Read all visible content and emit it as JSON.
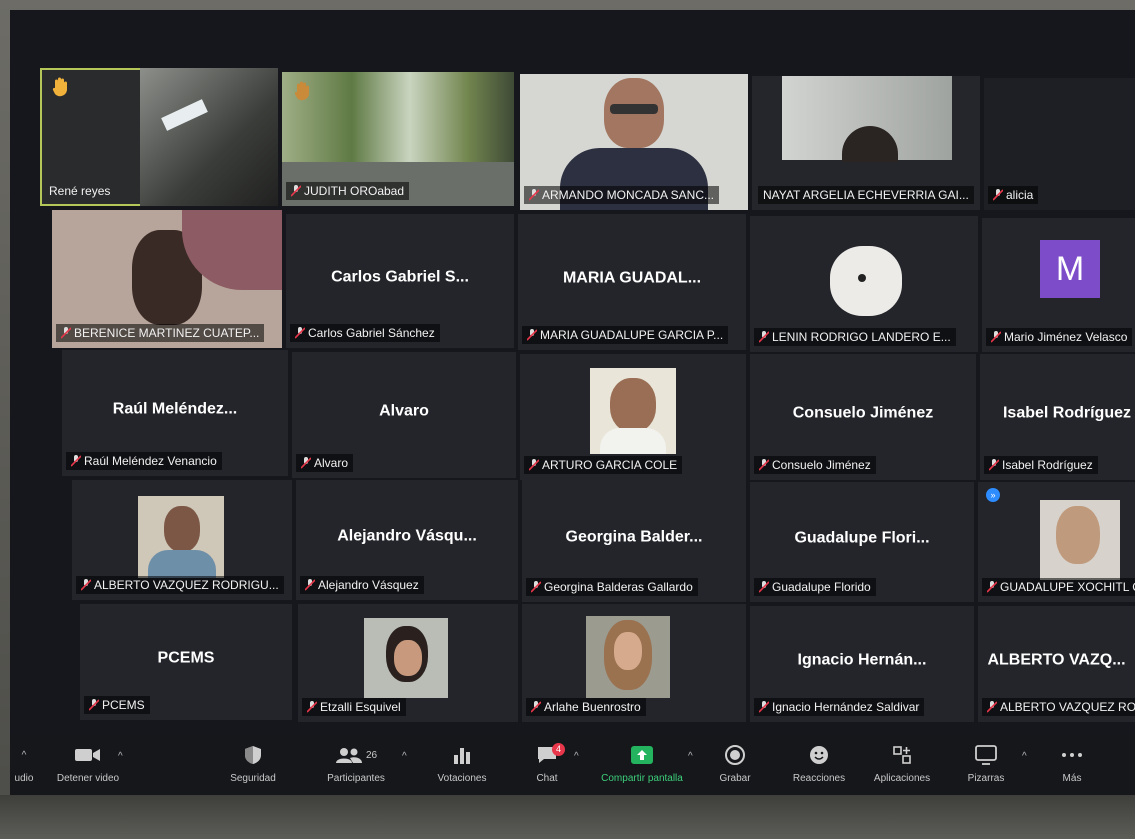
{
  "tiles": [
    {
      "center": "",
      "label": "René reyes",
      "muted": false
    },
    {
      "center": "",
      "label": "JUDITH OROabad",
      "muted": true
    },
    {
      "center": "",
      "label": "ARMANDO MONCADA SANC...",
      "muted": true
    },
    {
      "center": "",
      "label": "NAYAT ARGELIA ECHEVERRIA GAI...",
      "muted": false
    },
    {
      "center": "",
      "label": "alicia",
      "muted": true
    },
    {
      "center": "",
      "label": "BERENICE MARTINEZ CUATEP...",
      "muted": true
    },
    {
      "center": "Carlos Gabriel S...",
      "label": "Carlos Gabriel Sánchez",
      "muted": true
    },
    {
      "center": "MARIA GUADAL...",
      "label": "MARIA GUADALUPE GARCIA P...",
      "muted": true
    },
    {
      "center": "",
      "label": "LENIN RODRIGO LANDERO E...",
      "muted": true
    },
    {
      "center": "",
      "label": "Mario Jiménez Velasco",
      "muted": true,
      "avatar": "M"
    },
    {
      "center": "Raúl Meléndez...",
      "label": "Raúl Meléndez Venancio",
      "muted": true
    },
    {
      "center": "Alvaro",
      "label": "Alvaro",
      "muted": true
    },
    {
      "center": "",
      "label": "ARTURO GARCIA COLE",
      "muted": true
    },
    {
      "center": "Consuelo Jiménez",
      "label": "Consuelo Jiménez",
      "muted": true
    },
    {
      "center": "Isabel Rodríguez",
      "label": "Isabel Rodríguez",
      "muted": true
    },
    {
      "center": "",
      "label": "ALBERTO VAZQUEZ RODRIGU...",
      "muted": true
    },
    {
      "center": "Alejandro Vásqu...",
      "label": "Alejandro Vásquez",
      "muted": true
    },
    {
      "center": "Georgina Balder...",
      "label": "Georgina Balderas Gallardo",
      "muted": true
    },
    {
      "center": "Guadalupe Flori...",
      "label": "Guadalupe Florido",
      "muted": true
    },
    {
      "center": "",
      "label": "GUADALUPE XOCHITL CHAV",
      "muted": true
    },
    {
      "center": "PCEMS",
      "label": "PCEMS",
      "muted": true
    },
    {
      "center": "",
      "label": "Etzalli Esquivel",
      "muted": true
    },
    {
      "center": "",
      "label": "Arlahe Buenrostro",
      "muted": true
    },
    {
      "center": "Ignacio Hernán...",
      "label": "Ignacio Hernández Saldivar",
      "muted": true
    },
    {
      "center": "ALBERTO VAZQ...",
      "label": "ALBERTO VAZQUEZ RODRIGU",
      "muted": true
    }
  ],
  "toolbar": {
    "audio": "udio",
    "video": "Detener video",
    "security": "Seguridad",
    "participants": "Participantes",
    "participants_count": "26",
    "polls": "Votaciones",
    "chat": "Chat",
    "chat_badge": "4",
    "share": "Compartir pantalla",
    "record": "Grabar",
    "reactions": "Reacciones",
    "apps": "Aplicaciones",
    "whiteboards": "Pizarras",
    "more": "Más"
  },
  "colors": {
    "share_green": "#24b35e",
    "active_border": "#b6c75a",
    "badge_red": "#e8374a",
    "avatar_purple": "#7d4cc9"
  }
}
